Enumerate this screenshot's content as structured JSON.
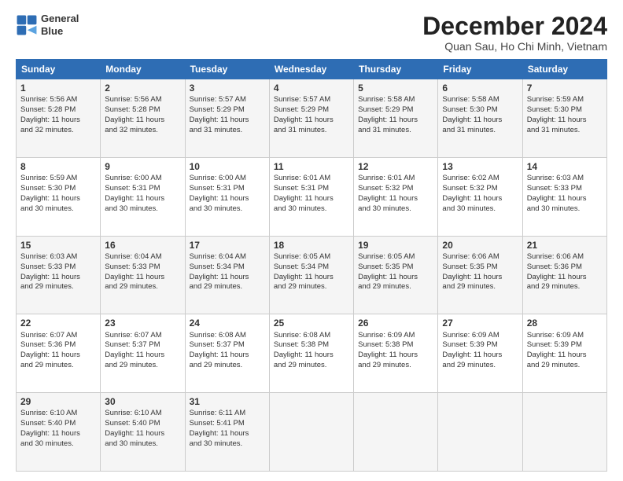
{
  "logo": {
    "line1": "General",
    "line2": "Blue"
  },
  "title": "December 2024",
  "subtitle": "Quan Sau, Ho Chi Minh, Vietnam",
  "headers": [
    "Sunday",
    "Monday",
    "Tuesday",
    "Wednesday",
    "Thursday",
    "Friday",
    "Saturday"
  ],
  "weeks": [
    [
      {
        "day": "1",
        "lines": [
          "Sunrise: 5:56 AM",
          "Sunset: 5:28 PM",
          "Daylight: 11 hours",
          "and 32 minutes."
        ]
      },
      {
        "day": "2",
        "lines": [
          "Sunrise: 5:56 AM",
          "Sunset: 5:28 PM",
          "Daylight: 11 hours",
          "and 32 minutes."
        ]
      },
      {
        "day": "3",
        "lines": [
          "Sunrise: 5:57 AM",
          "Sunset: 5:29 PM",
          "Daylight: 11 hours",
          "and 31 minutes."
        ]
      },
      {
        "day": "4",
        "lines": [
          "Sunrise: 5:57 AM",
          "Sunset: 5:29 PM",
          "Daylight: 11 hours",
          "and 31 minutes."
        ]
      },
      {
        "day": "5",
        "lines": [
          "Sunrise: 5:58 AM",
          "Sunset: 5:29 PM",
          "Daylight: 11 hours",
          "and 31 minutes."
        ]
      },
      {
        "day": "6",
        "lines": [
          "Sunrise: 5:58 AM",
          "Sunset: 5:30 PM",
          "Daylight: 11 hours",
          "and 31 minutes."
        ]
      },
      {
        "day": "7",
        "lines": [
          "Sunrise: 5:59 AM",
          "Sunset: 5:30 PM",
          "Daylight: 11 hours",
          "and 31 minutes."
        ]
      }
    ],
    [
      {
        "day": "8",
        "lines": [
          "Sunrise: 5:59 AM",
          "Sunset: 5:30 PM",
          "Daylight: 11 hours",
          "and 30 minutes."
        ]
      },
      {
        "day": "9",
        "lines": [
          "Sunrise: 6:00 AM",
          "Sunset: 5:31 PM",
          "Daylight: 11 hours",
          "and 30 minutes."
        ]
      },
      {
        "day": "10",
        "lines": [
          "Sunrise: 6:00 AM",
          "Sunset: 5:31 PM",
          "Daylight: 11 hours",
          "and 30 minutes."
        ]
      },
      {
        "day": "11",
        "lines": [
          "Sunrise: 6:01 AM",
          "Sunset: 5:31 PM",
          "Daylight: 11 hours",
          "and 30 minutes."
        ]
      },
      {
        "day": "12",
        "lines": [
          "Sunrise: 6:01 AM",
          "Sunset: 5:32 PM",
          "Daylight: 11 hours",
          "and 30 minutes."
        ]
      },
      {
        "day": "13",
        "lines": [
          "Sunrise: 6:02 AM",
          "Sunset: 5:32 PM",
          "Daylight: 11 hours",
          "and 30 minutes."
        ]
      },
      {
        "day": "14",
        "lines": [
          "Sunrise: 6:03 AM",
          "Sunset: 5:33 PM",
          "Daylight: 11 hours",
          "and 30 minutes."
        ]
      }
    ],
    [
      {
        "day": "15",
        "lines": [
          "Sunrise: 6:03 AM",
          "Sunset: 5:33 PM",
          "Daylight: 11 hours",
          "and 29 minutes."
        ]
      },
      {
        "day": "16",
        "lines": [
          "Sunrise: 6:04 AM",
          "Sunset: 5:33 PM",
          "Daylight: 11 hours",
          "and 29 minutes."
        ]
      },
      {
        "day": "17",
        "lines": [
          "Sunrise: 6:04 AM",
          "Sunset: 5:34 PM",
          "Daylight: 11 hours",
          "and 29 minutes."
        ]
      },
      {
        "day": "18",
        "lines": [
          "Sunrise: 6:05 AM",
          "Sunset: 5:34 PM",
          "Daylight: 11 hours",
          "and 29 minutes."
        ]
      },
      {
        "day": "19",
        "lines": [
          "Sunrise: 6:05 AM",
          "Sunset: 5:35 PM",
          "Daylight: 11 hours",
          "and 29 minutes."
        ]
      },
      {
        "day": "20",
        "lines": [
          "Sunrise: 6:06 AM",
          "Sunset: 5:35 PM",
          "Daylight: 11 hours",
          "and 29 minutes."
        ]
      },
      {
        "day": "21",
        "lines": [
          "Sunrise: 6:06 AM",
          "Sunset: 5:36 PM",
          "Daylight: 11 hours",
          "and 29 minutes."
        ]
      }
    ],
    [
      {
        "day": "22",
        "lines": [
          "Sunrise: 6:07 AM",
          "Sunset: 5:36 PM",
          "Daylight: 11 hours",
          "and 29 minutes."
        ]
      },
      {
        "day": "23",
        "lines": [
          "Sunrise: 6:07 AM",
          "Sunset: 5:37 PM",
          "Daylight: 11 hours",
          "and 29 minutes."
        ]
      },
      {
        "day": "24",
        "lines": [
          "Sunrise: 6:08 AM",
          "Sunset: 5:37 PM",
          "Daylight: 11 hours",
          "and 29 minutes."
        ]
      },
      {
        "day": "25",
        "lines": [
          "Sunrise: 6:08 AM",
          "Sunset: 5:38 PM",
          "Daylight: 11 hours",
          "and 29 minutes."
        ]
      },
      {
        "day": "26",
        "lines": [
          "Sunrise: 6:09 AM",
          "Sunset: 5:38 PM",
          "Daylight: 11 hours",
          "and 29 minutes."
        ]
      },
      {
        "day": "27",
        "lines": [
          "Sunrise: 6:09 AM",
          "Sunset: 5:39 PM",
          "Daylight: 11 hours",
          "and 29 minutes."
        ]
      },
      {
        "day": "28",
        "lines": [
          "Sunrise: 6:09 AM",
          "Sunset: 5:39 PM",
          "Daylight: 11 hours",
          "and 29 minutes."
        ]
      }
    ],
    [
      {
        "day": "29",
        "lines": [
          "Sunrise: 6:10 AM",
          "Sunset: 5:40 PM",
          "Daylight: 11 hours",
          "and 30 minutes."
        ]
      },
      {
        "day": "30",
        "lines": [
          "Sunrise: 6:10 AM",
          "Sunset: 5:40 PM",
          "Daylight: 11 hours",
          "and 30 minutes."
        ]
      },
      {
        "day": "31",
        "lines": [
          "Sunrise: 6:11 AM",
          "Sunset: 5:41 PM",
          "Daylight: 11 hours",
          "and 30 minutes."
        ]
      },
      null,
      null,
      null,
      null
    ]
  ]
}
